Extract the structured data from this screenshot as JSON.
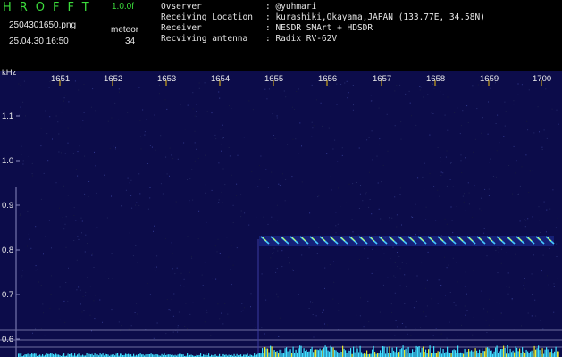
{
  "header": {
    "app_title": "HROFFT",
    "version": "1.0.0f",
    "filename": "2504301650.png",
    "datetime": "25.04.30 16:50",
    "meteor_label": "meteor",
    "meteor_count": "34",
    "info": [
      {
        "key": "Ovserver",
        "value": ": @yuhmari"
      },
      {
        "key": "Receiving Location",
        "value": ": kurashiki,Okayama,JAPAN (133.77E, 34.58N)"
      },
      {
        "key": "Receiver",
        "value": ": NESDR SMArt + HDSDR"
      },
      {
        "key": "Recviving antenna",
        "value": ": Radix RV-62V"
      }
    ]
  },
  "spectrogram": {
    "y_unit": "kHz",
    "time_ticks": [
      "1651",
      "1652",
      "1653",
      "1654",
      "1655",
      "1656",
      "1657",
      "1658",
      "1659",
      "1700"
    ],
    "freq_ticks": [
      "1.1",
      "1.0",
      "0.9",
      "0.8",
      "0.7",
      "0.6"
    ],
    "colors": {
      "background": "#0c0c4a",
      "grid": "#6e6ea0",
      "tick": "#f0c010",
      "signal": "#46c8ff",
      "noise": "#40e0ff"
    }
  }
}
